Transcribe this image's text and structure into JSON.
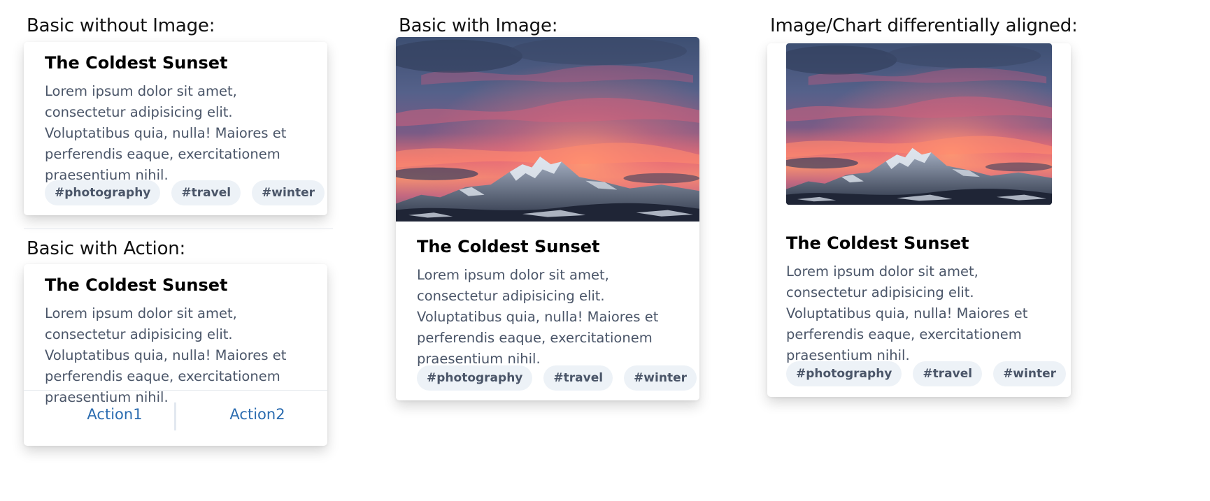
{
  "sections": {
    "basic_no_image": "Basic without Image:",
    "basic_action": "Basic with Action:",
    "basic_image": "Basic with Image:",
    "aligned": "Image/Chart differentially aligned:"
  },
  "card": {
    "title": "The Coldest Sunset",
    "text": "Lorem ipsum dolor sit amet, consectetur adipisicing elit. Voluptatibus quia, nulla! Maiores et perferendis eaque, exercitationem praesentium nihil.",
    "tags": [
      "#photography",
      "#travel",
      "#winter"
    ]
  },
  "actions": {
    "action1": "Action1",
    "action2": "Action2"
  },
  "colors": {
    "tag_bg": "#edf2f7",
    "body_text": "#4a5568",
    "link": "#2b6cb0"
  },
  "image": {
    "subject": "mountain-sunset-photo"
  }
}
